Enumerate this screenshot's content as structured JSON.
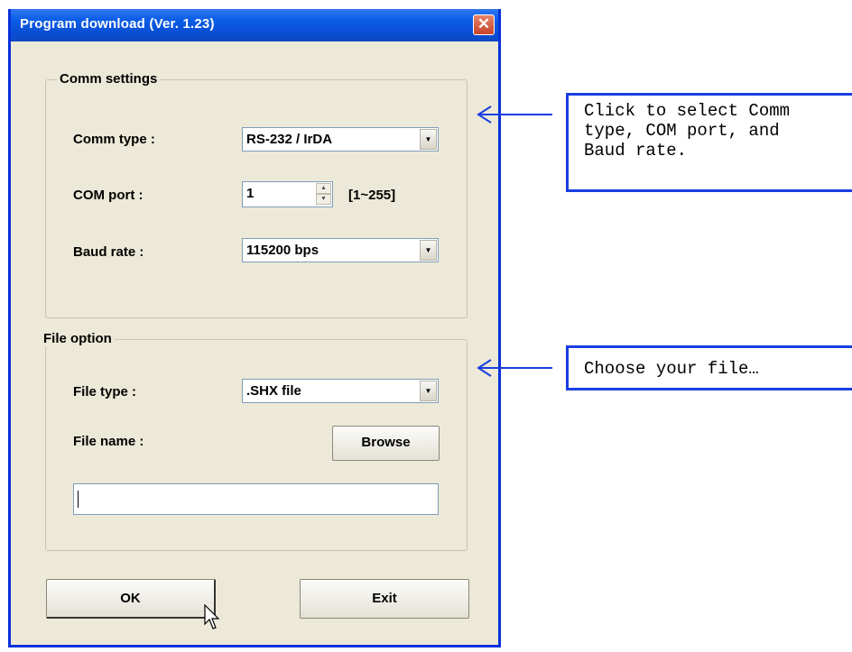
{
  "window": {
    "title": "Program download  (Ver. 1.23)",
    "close_glyph": "✕"
  },
  "comm": {
    "group_label": "Comm settings",
    "type_label": "Comm type :",
    "type_value": "RS-232 / IrDA",
    "port_label": "COM port :",
    "port_value": "1",
    "port_range": "[1~255]",
    "baud_label": "Baud rate :",
    "baud_value": "115200 bps"
  },
  "file": {
    "group_label": "File option",
    "type_label": "File type :",
    "type_value": ".SHX file",
    "name_label": "File name :",
    "browse_label": "Browse",
    "name_value": ""
  },
  "buttons": {
    "ok_label": "OK",
    "exit_label": "Exit"
  },
  "annotations": {
    "comm_note": "Click to select Comm\ntype, COM port, and\nBaud rate.",
    "file_note": "Choose your file…",
    "color": "#1a3ee0"
  },
  "icons": {
    "dropdown": "triangle-down",
    "spin_up": "triangle-up",
    "spin_down": "triangle-down",
    "close": "close-x",
    "cursor": "mouse-pointer"
  }
}
